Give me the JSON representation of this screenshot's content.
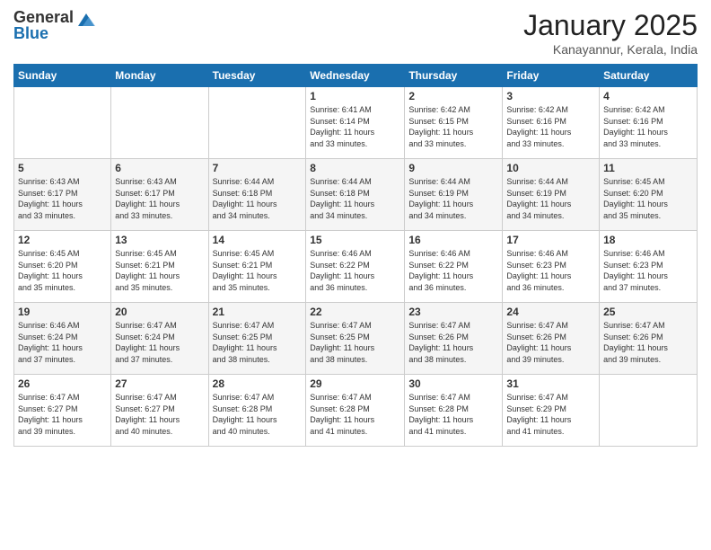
{
  "logo": {
    "general": "General",
    "blue": "Blue"
  },
  "title": "January 2025",
  "location": "Kanayannur, Kerala, India",
  "days_of_week": [
    "Sunday",
    "Monday",
    "Tuesday",
    "Wednesday",
    "Thursday",
    "Friday",
    "Saturday"
  ],
  "weeks": [
    [
      {
        "day": "",
        "info": ""
      },
      {
        "day": "",
        "info": ""
      },
      {
        "day": "",
        "info": ""
      },
      {
        "day": "1",
        "info": "Sunrise: 6:41 AM\nSunset: 6:14 PM\nDaylight: 11 hours\nand 33 minutes."
      },
      {
        "day": "2",
        "info": "Sunrise: 6:42 AM\nSunset: 6:15 PM\nDaylight: 11 hours\nand 33 minutes."
      },
      {
        "day": "3",
        "info": "Sunrise: 6:42 AM\nSunset: 6:16 PM\nDaylight: 11 hours\nand 33 minutes."
      },
      {
        "day": "4",
        "info": "Sunrise: 6:42 AM\nSunset: 6:16 PM\nDaylight: 11 hours\nand 33 minutes."
      }
    ],
    [
      {
        "day": "5",
        "info": "Sunrise: 6:43 AM\nSunset: 6:17 PM\nDaylight: 11 hours\nand 33 minutes."
      },
      {
        "day": "6",
        "info": "Sunrise: 6:43 AM\nSunset: 6:17 PM\nDaylight: 11 hours\nand 33 minutes."
      },
      {
        "day": "7",
        "info": "Sunrise: 6:44 AM\nSunset: 6:18 PM\nDaylight: 11 hours\nand 34 minutes."
      },
      {
        "day": "8",
        "info": "Sunrise: 6:44 AM\nSunset: 6:18 PM\nDaylight: 11 hours\nand 34 minutes."
      },
      {
        "day": "9",
        "info": "Sunrise: 6:44 AM\nSunset: 6:19 PM\nDaylight: 11 hours\nand 34 minutes."
      },
      {
        "day": "10",
        "info": "Sunrise: 6:44 AM\nSunset: 6:19 PM\nDaylight: 11 hours\nand 34 minutes."
      },
      {
        "day": "11",
        "info": "Sunrise: 6:45 AM\nSunset: 6:20 PM\nDaylight: 11 hours\nand 35 minutes."
      }
    ],
    [
      {
        "day": "12",
        "info": "Sunrise: 6:45 AM\nSunset: 6:20 PM\nDaylight: 11 hours\nand 35 minutes."
      },
      {
        "day": "13",
        "info": "Sunrise: 6:45 AM\nSunset: 6:21 PM\nDaylight: 11 hours\nand 35 minutes."
      },
      {
        "day": "14",
        "info": "Sunrise: 6:45 AM\nSunset: 6:21 PM\nDaylight: 11 hours\nand 35 minutes."
      },
      {
        "day": "15",
        "info": "Sunrise: 6:46 AM\nSunset: 6:22 PM\nDaylight: 11 hours\nand 36 minutes."
      },
      {
        "day": "16",
        "info": "Sunrise: 6:46 AM\nSunset: 6:22 PM\nDaylight: 11 hours\nand 36 minutes."
      },
      {
        "day": "17",
        "info": "Sunrise: 6:46 AM\nSunset: 6:23 PM\nDaylight: 11 hours\nand 36 minutes."
      },
      {
        "day": "18",
        "info": "Sunrise: 6:46 AM\nSunset: 6:23 PM\nDaylight: 11 hours\nand 37 minutes."
      }
    ],
    [
      {
        "day": "19",
        "info": "Sunrise: 6:46 AM\nSunset: 6:24 PM\nDaylight: 11 hours\nand 37 minutes."
      },
      {
        "day": "20",
        "info": "Sunrise: 6:47 AM\nSunset: 6:24 PM\nDaylight: 11 hours\nand 37 minutes."
      },
      {
        "day": "21",
        "info": "Sunrise: 6:47 AM\nSunset: 6:25 PM\nDaylight: 11 hours\nand 38 minutes."
      },
      {
        "day": "22",
        "info": "Sunrise: 6:47 AM\nSunset: 6:25 PM\nDaylight: 11 hours\nand 38 minutes."
      },
      {
        "day": "23",
        "info": "Sunrise: 6:47 AM\nSunset: 6:26 PM\nDaylight: 11 hours\nand 38 minutes."
      },
      {
        "day": "24",
        "info": "Sunrise: 6:47 AM\nSunset: 6:26 PM\nDaylight: 11 hours\nand 39 minutes."
      },
      {
        "day": "25",
        "info": "Sunrise: 6:47 AM\nSunset: 6:26 PM\nDaylight: 11 hours\nand 39 minutes."
      }
    ],
    [
      {
        "day": "26",
        "info": "Sunrise: 6:47 AM\nSunset: 6:27 PM\nDaylight: 11 hours\nand 39 minutes."
      },
      {
        "day": "27",
        "info": "Sunrise: 6:47 AM\nSunset: 6:27 PM\nDaylight: 11 hours\nand 40 minutes."
      },
      {
        "day": "28",
        "info": "Sunrise: 6:47 AM\nSunset: 6:28 PM\nDaylight: 11 hours\nand 40 minutes."
      },
      {
        "day": "29",
        "info": "Sunrise: 6:47 AM\nSunset: 6:28 PM\nDaylight: 11 hours\nand 41 minutes."
      },
      {
        "day": "30",
        "info": "Sunrise: 6:47 AM\nSunset: 6:28 PM\nDaylight: 11 hours\nand 41 minutes."
      },
      {
        "day": "31",
        "info": "Sunrise: 6:47 AM\nSunset: 6:29 PM\nDaylight: 11 hours\nand 41 minutes."
      },
      {
        "day": "",
        "info": ""
      }
    ]
  ]
}
